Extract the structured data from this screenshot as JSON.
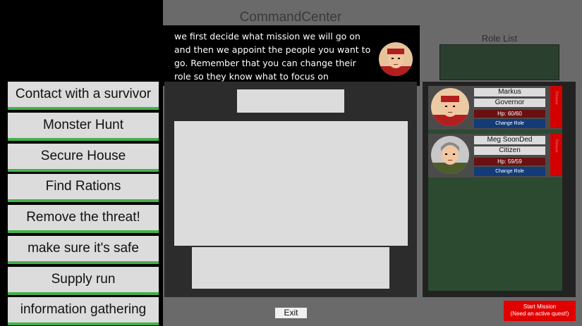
{
  "title": "CommandCenter",
  "dialog": {
    "text": "we first decide what mission we will go on and then we appoint the people you want to go. Remember that you can change their role so they know what to focus on"
  },
  "missions": [
    "Contact with a survivor",
    "Monster Hunt",
    "Secure House",
    "Find Rations",
    "Remove the threat!",
    "make sure it's safe",
    "Supply run",
    "information gathering"
  ],
  "role_list": {
    "label": "Role List"
  },
  "roster": [
    {
      "name": "Markus",
      "role": "Governor",
      "hp": "Hp: 60/60",
      "change_role": "Change Role",
      "side": "Remove"
    },
    {
      "name": "Meg SoonDed",
      "role": "Citizen",
      "hp": "Hp: 59/59",
      "change_role": "Change Role",
      "side": "Remove"
    }
  ],
  "exit_label": "Exit",
  "start": {
    "line1": "Start Mission",
    "line2": "(Need an active quest!)"
  },
  "colors": {
    "accent_green": "#45b049",
    "danger_red": "#e00000",
    "roster_green": "#2c4a30"
  }
}
